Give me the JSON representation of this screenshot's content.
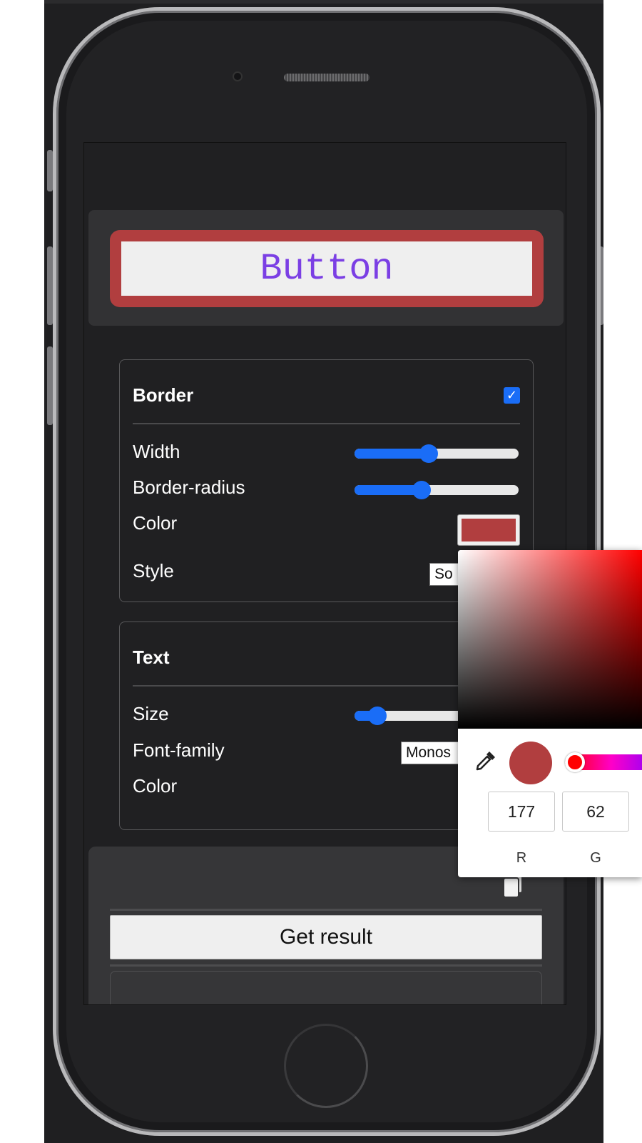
{
  "preview": {
    "button_text": "Button"
  },
  "border_panel": {
    "title": "Border",
    "enabled": true,
    "rows": {
      "width": "Width",
      "radius": "Border-radius",
      "color": "Color",
      "style": "Style"
    },
    "width_level": 0.45,
    "radius_level": 0.41,
    "color": "#b13e3f",
    "style_value": "So"
  },
  "text_panel": {
    "title": "Text",
    "rows": {
      "size": "Size",
      "font_family": "Font-family",
      "color": "Color"
    },
    "size_level": 0.14,
    "font_family_value": "Monos"
  },
  "result": {
    "get_result_label": "Get result",
    "copy_icon": "copy-icon"
  },
  "color_picker": {
    "preview_color": "#b13e3f",
    "hue_color": "#ff0000",
    "eyedropper_icon": "eyedropper-icon",
    "r_value": "177",
    "g_value": "62",
    "r_label": "R",
    "g_label": "G"
  },
  "colors": {
    "accent": "#1a6df7",
    "border_color": "#b13e3f",
    "text_color": "#7b3fe4",
    "screen_bg": "#202022"
  }
}
